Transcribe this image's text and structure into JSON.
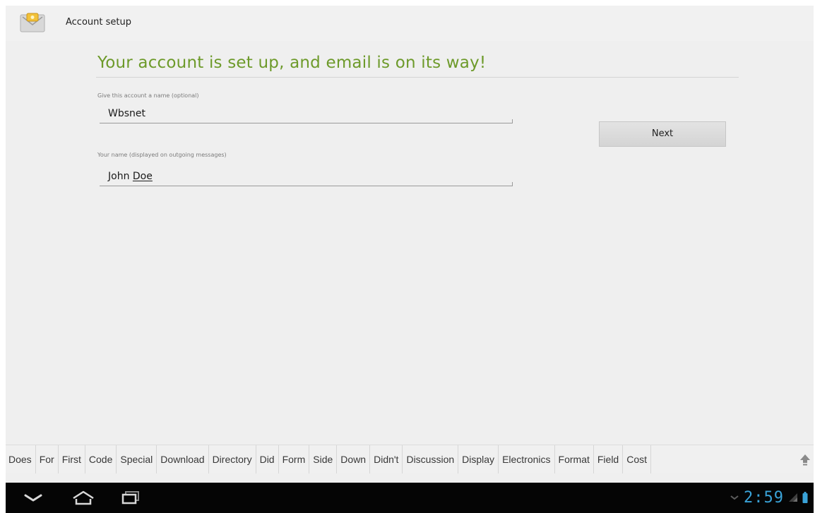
{
  "app": {
    "title": "Account setup",
    "icon": "email-envelope-icon"
  },
  "main": {
    "headline": "Your account is set up, and email is on its way!",
    "account_name": {
      "label": "Give this account a name (optional)",
      "value": "Wbsnet"
    },
    "your_name": {
      "label": "Your name (displayed on outgoing messages)",
      "first": "John",
      "last": "Doe"
    },
    "next_label": "Next"
  },
  "suggestions": [
    "Does",
    "For",
    "First",
    "Code",
    "Special",
    "Download",
    "Directory",
    "Did",
    "Form",
    "Side",
    "Down",
    "Didn't",
    "Discussion",
    "Display",
    "Electronics",
    "Format",
    "Field",
    "Cost"
  ],
  "nav": {
    "back_icon": "back-chevron-icon",
    "home_icon": "home-icon",
    "recents_icon": "recent-apps-icon"
  },
  "status": {
    "time": "2:59",
    "icons": [
      "keyboard-icon",
      "signal-icon",
      "battery-icon"
    ]
  },
  "colors": {
    "headline": "#6d9a2a",
    "clock": "#3aa3d8",
    "nav_bar": "#050505"
  }
}
